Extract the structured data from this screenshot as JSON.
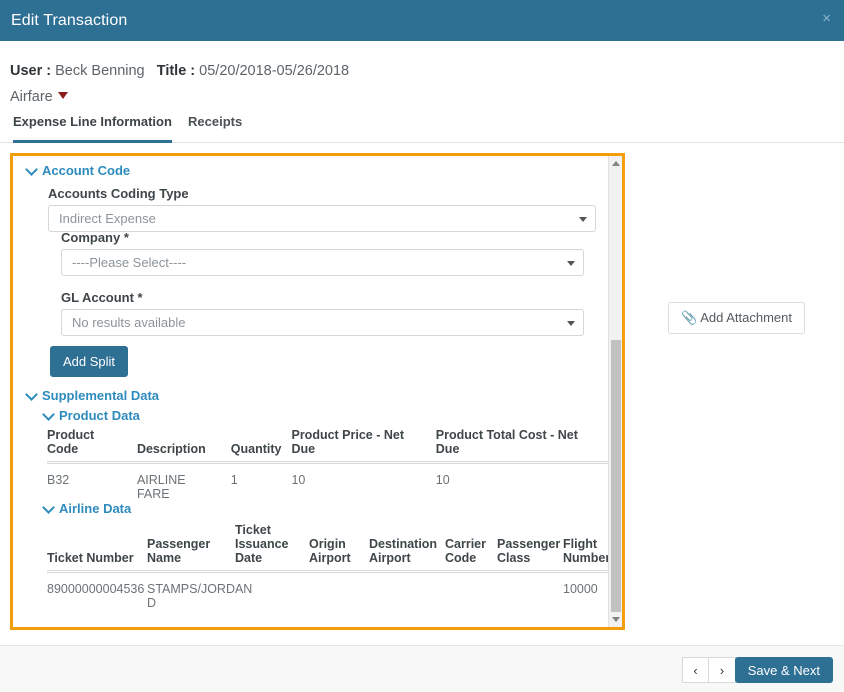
{
  "window": {
    "title": "Edit Transaction",
    "close_label": "×",
    "accent_color": "#2e6f94",
    "highlight_color": "#f59e0b",
    "link_color": "#2e8bbd"
  },
  "meta": {
    "user_label": "User :",
    "user_value": "Beck Benning",
    "title_label": "Title :",
    "title_value": "05/20/2018-05/26/2018",
    "category": "Airfare"
  },
  "tabs": [
    {
      "label": "Expense Line Information",
      "active": true
    },
    {
      "label": "Receipts",
      "active": false
    }
  ],
  "account_code": {
    "section_title": "Account Code",
    "fields": [
      {
        "label": "Accounts Coding Type",
        "value": "Indirect Expense"
      },
      {
        "label": "Company *",
        "value": "----Please Select----"
      },
      {
        "label": "GL Account *",
        "value": "No results available"
      }
    ],
    "add_split_label": "Add Split"
  },
  "supplemental": {
    "section_title": "Supplemental Data",
    "product_data": {
      "section_title": "Product Data",
      "columns": [
        "Product Code",
        "Description",
        "Quantity",
        "Product Price - Net Due",
        "Product Total Cost - Net Due"
      ],
      "rows": [
        [
          "B32",
          "AIRLINE FARE",
          "1",
          "10",
          "10"
        ]
      ]
    },
    "airline_data": {
      "section_title": "Airline Data",
      "columns": [
        "Ticket Number",
        "Passenger Name",
        "Ticket Issuance Date",
        "Origin Airport",
        "Destination Airport",
        "Carrier Code",
        "Passenger Class",
        "Flight Number"
      ],
      "rows": [
        [
          "89000000004536",
          "STAMPS/JORDAN D",
          "",
          "",
          "",
          "",
          "",
          "10000"
        ]
      ]
    }
  },
  "attachment": {
    "label": "Add Attachment",
    "icon": "paperclip-icon"
  },
  "footer": {
    "prev_label": "‹",
    "next_label": "›",
    "save_label": "Save & Next"
  }
}
